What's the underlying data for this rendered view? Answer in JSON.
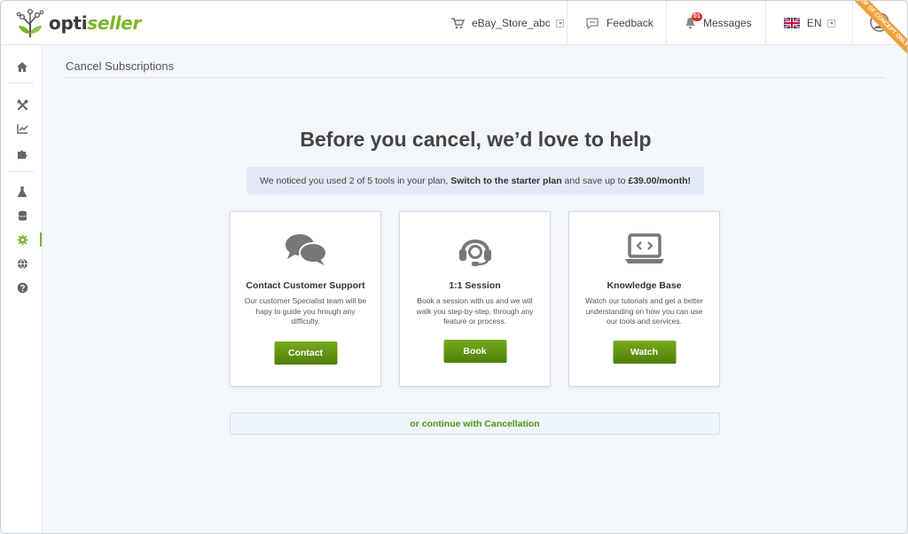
{
  "app": {
    "logo_part1": "opti",
    "logo_part2": "seller",
    "ribbon_text": "Proof of concept only"
  },
  "header": {
    "store": {
      "label": "eBay_Store_abc",
      "icon": "cart-icon"
    },
    "feedback": {
      "label": "Feedback",
      "icon": "chat-bubble-icon"
    },
    "messages": {
      "label": "Messages",
      "badge": "01",
      "icon": "bell-icon"
    },
    "language": {
      "label": "EN",
      "icon": "uk-flag-icon"
    },
    "avatar": {
      "icon": "user-avatar-icon"
    }
  },
  "sidebar": {
    "items": [
      {
        "name": "home",
        "icon": "home-icon"
      },
      {
        "name": "tools",
        "icon": "tools-icon"
      },
      {
        "name": "analytics",
        "icon": "chart-line-icon"
      },
      {
        "name": "integrations",
        "icon": "puzzle-icon"
      },
      {
        "name": "labs",
        "icon": "flask-icon"
      },
      {
        "name": "database",
        "icon": "database-icon"
      },
      {
        "name": "settings",
        "icon": "gear-icon",
        "active": true
      },
      {
        "name": "global",
        "icon": "globe-icon"
      },
      {
        "name": "help",
        "icon": "help-icon"
      }
    ]
  },
  "page": {
    "title": "Cancel Subscriptions",
    "headline": "Before you cancel, we’d love to help",
    "notice": {
      "prefix": "We noticed you used 2 of 5 tools in your plan, ",
      "highlight": "Switch to the starter plan",
      "middle": " and save up to ",
      "amount": "£39.00/month!"
    },
    "cards": [
      {
        "icon": "chat-bubbles-icon",
        "title": "Contact Customer Support",
        "description": "Our customer Specialist team will be hapy to guide you hrough any difficulty.",
        "button": "Contact"
      },
      {
        "icon": "headset-icon",
        "title": "1:1 Session",
        "description": "Book a session with us and we will walk you step-by-step, through any feature or process.",
        "button": "Book"
      },
      {
        "icon": "laptop-code-icon",
        "title": "Knowledge Base",
        "description": "Watch our tutorials and get a better understanding on how you can use our tools and services.",
        "button": "Watch"
      }
    ],
    "continue_label": "or continue with Cancellation"
  },
  "colors": {
    "brand_green": "#7db52a",
    "button_green": "#5c8d10",
    "notice_bg": "#e3e8f6",
    "ribbon": "#f0a13a",
    "badge_red": "#d9302c"
  }
}
